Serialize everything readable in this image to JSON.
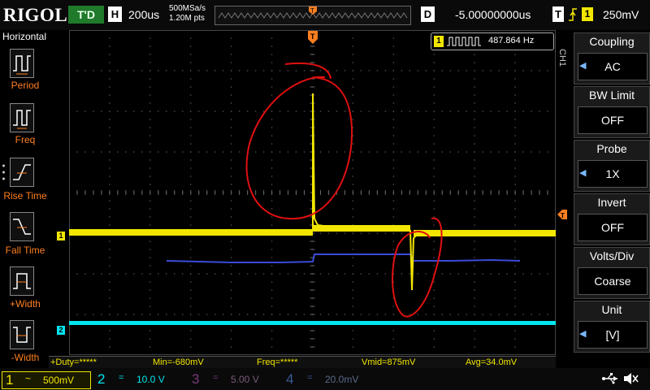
{
  "topbar": {
    "logo": "RIGOL",
    "trigger_status": "T'D",
    "horizontal_label": "H",
    "timebase": "200us",
    "sample_rate": "500MSa/s",
    "memory_points": "1.20M pts",
    "delay_label": "D",
    "delay_value": "-5.00000000us",
    "trigger_label": "T",
    "trigger_source": "1",
    "trigger_level": "250mV"
  },
  "left_menu": {
    "title": "Horizontal",
    "items": [
      {
        "label": "Period"
      },
      {
        "label": "Freq"
      },
      {
        "label": "Rise Time"
      },
      {
        "label": "Fall Time"
      },
      {
        "label": "+Width"
      },
      {
        "label": "-Width"
      }
    ]
  },
  "screen": {
    "freq_badge_channel": "1",
    "frequency": "487.864 Hz",
    "ch1_marker": "1",
    "ch2_marker": "2"
  },
  "measurements": [
    "+Duty=*****",
    "Min=-680mV",
    "Freq=*****",
    "Vmid=875mV",
    "Avg=34.0mV"
  ],
  "channels": [
    {
      "num": "1",
      "coupling_symbol": "~",
      "scale": "500mV"
    },
    {
      "num": "2",
      "coupling_symbol": "=",
      "scale": "10.0 V"
    },
    {
      "num": "3",
      "coupling_symbol": "=",
      "scale": "5.00 V"
    },
    {
      "num": "4",
      "coupling_symbol": "=",
      "scale": "20.0mV"
    }
  ],
  "right_menu": {
    "title": "CH1",
    "items": [
      {
        "label": "Coupling",
        "value": "AC"
      },
      {
        "label": "BW Limit",
        "value": "OFF"
      },
      {
        "label": "Probe",
        "value": "1X"
      },
      {
        "label": "Invert",
        "value": "OFF"
      },
      {
        "label": "Volts/Div",
        "value": "Coarse"
      },
      {
        "label": "Unit",
        "value": "[V]"
      }
    ]
  },
  "colors": {
    "ch1": "#f2e600",
    "ch2": "#00e5ee",
    "ref_trace": "#3a4bd8",
    "annotation": "#e01010",
    "accent": "#ff7f20"
  },
  "icons": {
    "usb": "usb-icon",
    "speaker": "speaker-muted-icon"
  }
}
